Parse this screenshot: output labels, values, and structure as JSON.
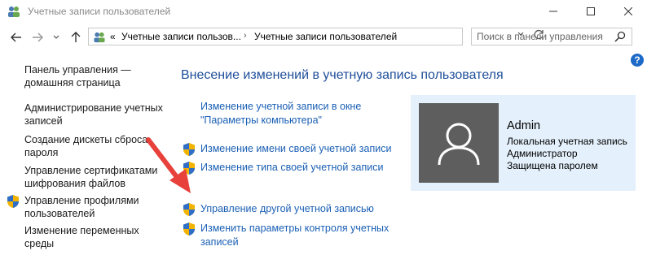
{
  "window": {
    "title": "Учетные записи пользователей"
  },
  "address": {
    "overflow": "«",
    "crumbs": [
      "Учетные записи пользов...",
      "Учетные записи пользователей"
    ]
  },
  "search": {
    "placeholder": "Поиск в панели управления",
    "value": ""
  },
  "help": {
    "label": "?"
  },
  "sidebar": {
    "items": [
      {
        "label": "Панель управления — домашняя страница",
        "shield": false
      },
      {
        "label": "Администрирование учетных записей",
        "shield": false
      },
      {
        "label": "Создание дискеты сброса пароля",
        "shield": false
      },
      {
        "label": "Управление сертификатами шифрования файлов",
        "shield": false
      },
      {
        "label": "Управление профилями пользователей",
        "shield": true
      },
      {
        "label": "Изменение переменных среды",
        "shield": false
      }
    ]
  },
  "main": {
    "heading": "Внесение изменений в учетную запись пользователя",
    "tasks": [
      {
        "label": "Изменение учетной записи в окне \"Параметры компьютера\"",
        "shield": false
      },
      {
        "label": "Изменение имени своей учетной записи",
        "shield": true
      },
      {
        "label": "Изменение типа своей учетной записи",
        "shield": true
      },
      {
        "label": "Управление другой учетной записью",
        "shield": true
      },
      {
        "label": "Изменить параметры контроля учетных записей",
        "shield": true
      }
    ]
  },
  "account": {
    "name": "Admin",
    "type": "Локальная учетная запись",
    "role": "Администратор",
    "protection": "Защищена паролем"
  },
  "colors": {
    "link": "#1a5fb4",
    "heading": "#1e4e9a",
    "card": "#e4f0fb",
    "avatar": "#5e5e5e",
    "arrow": "#e8403a"
  }
}
